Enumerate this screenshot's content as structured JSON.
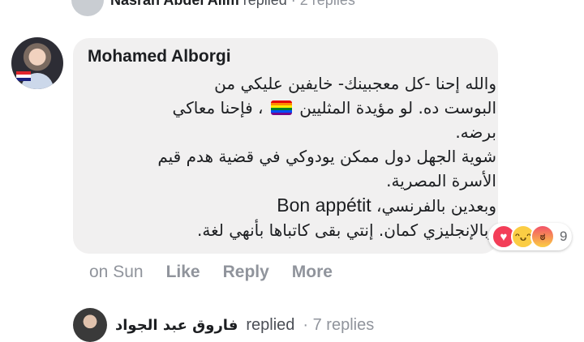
{
  "top_reply": {
    "name": "Nasran Abdel Alim",
    "replied": "replied",
    "count": "· 2 replies"
  },
  "comment": {
    "author": "Mohamed Alborgi",
    "lines": {
      "l1": "والله إحنا -كل معجبينك- خايفين عليكي من",
      "l2a": "البوست ده. لو مؤيدة المثليين",
      "l2b": "، فإحنا معاكي",
      "l3": "برضه.",
      "l4": "شوية الجهل دول ممكن يودوكي في قضية هدم قيم",
      "l5": "الأسرة المصرية.",
      "l6a": "وبعدين بالفرنسي،",
      "l6b": "Bon appétit",
      "l7": "وبالإنجليزي كمان. إنتي بقى كاتباها بأنهي لغة."
    },
    "emoji": "rainbow-flag-icon"
  },
  "reactions": {
    "icons": [
      "love-icon",
      "haha-icon",
      "angry-icon"
    ],
    "count": "9"
  },
  "actions": {
    "time": "on Sun",
    "like": "Like",
    "reply": "Reply",
    "more": "More"
  },
  "bottom_reply": {
    "name": "فاروق عبد الجواد",
    "replied": "replied",
    "count": "· 7 replies"
  }
}
